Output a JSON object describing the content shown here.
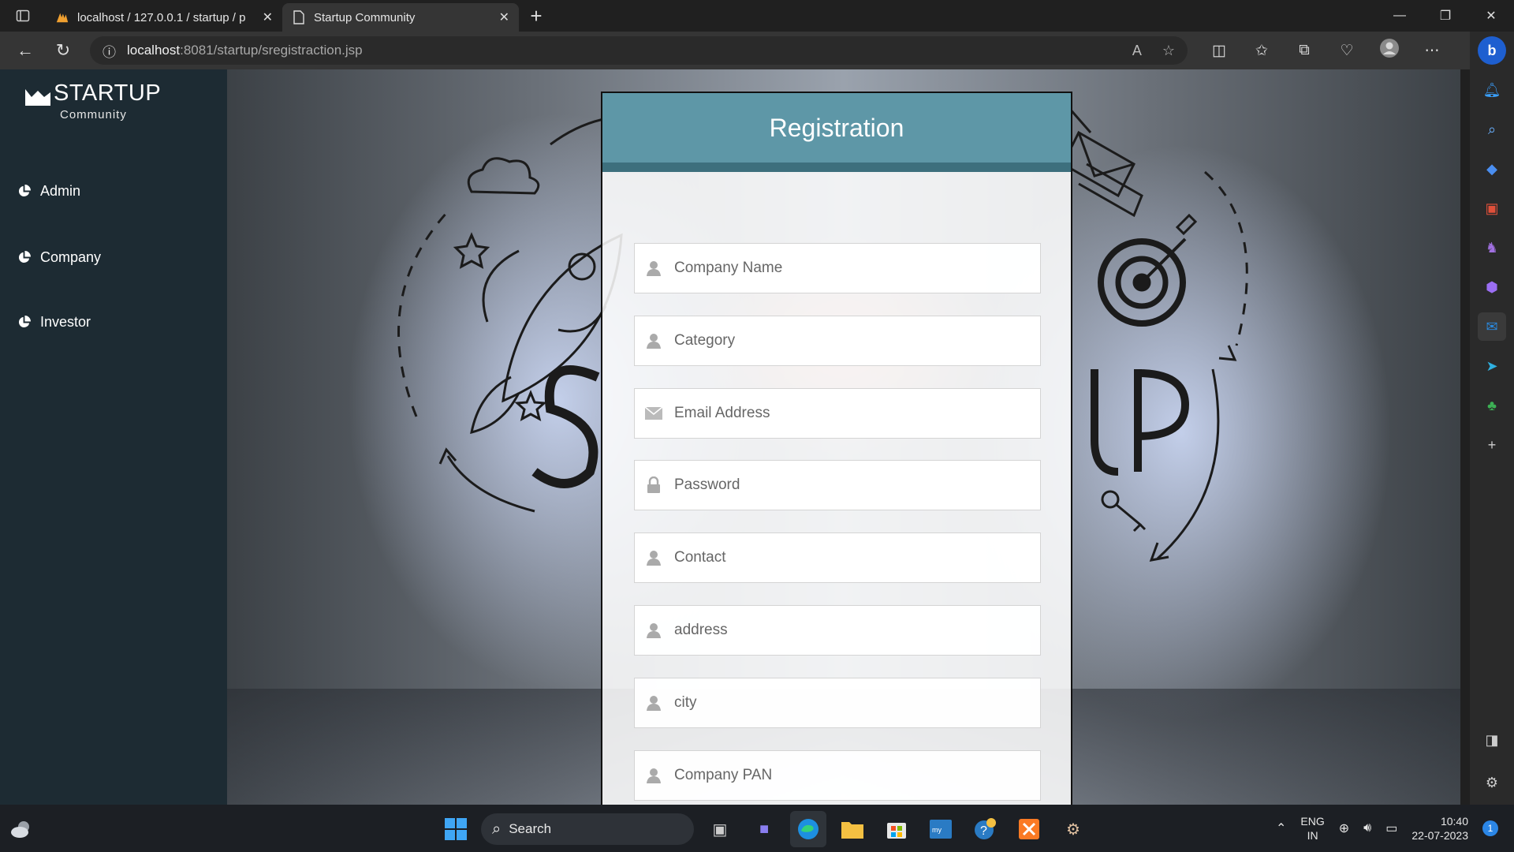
{
  "browser": {
    "tabs": [
      {
        "title": "localhost / 127.0.0.1 / startup / p",
        "active": false,
        "icon": "phpmyadmin-icon"
      },
      {
        "title": "Startup Community",
        "active": true,
        "icon": "page-icon"
      }
    ],
    "url_host": "localhost",
    "url_path": ":8081/startup/sregistraction.jsp"
  },
  "sidebar": {
    "brand_name": "STARTUP",
    "brand_sub": "Community",
    "items": [
      {
        "label": "Admin"
      },
      {
        "label": "Company"
      },
      {
        "label": "Investor"
      }
    ]
  },
  "registration": {
    "title": "Registration",
    "fields": [
      {
        "placeholder": "Company Name",
        "icon": "user-icon"
      },
      {
        "placeholder": "Category",
        "icon": "user-icon"
      },
      {
        "placeholder": "Email Address",
        "icon": "envelope-icon"
      },
      {
        "placeholder": "Password",
        "icon": "lock-icon"
      },
      {
        "placeholder": "Contact",
        "icon": "user-icon"
      },
      {
        "placeholder": "address",
        "icon": "user-icon"
      },
      {
        "placeholder": "city",
        "icon": "user-icon"
      },
      {
        "placeholder": "Company PAN",
        "icon": "user-icon"
      }
    ]
  },
  "taskbar": {
    "search_label": "Search",
    "lang_top": "ENG",
    "lang_bottom": "IN",
    "time": "10:40",
    "date": "22-07-2023",
    "notification_count": "1"
  },
  "colors": {
    "sidebar_bg": "#1d2b33",
    "header_bg": "#5e97a7",
    "header_border": "#3d6f7d"
  }
}
